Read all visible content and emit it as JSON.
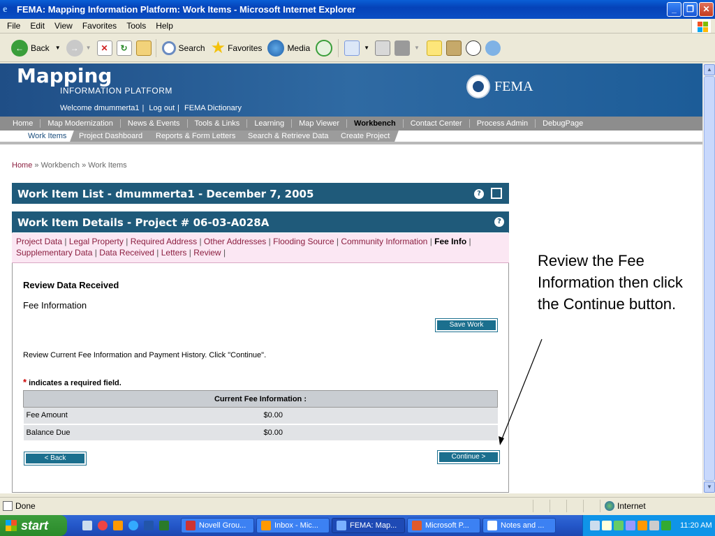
{
  "window": {
    "title": "FEMA: Mapping Information Platform: Work Items - Microsoft Internet Explorer"
  },
  "menu": [
    "File",
    "Edit",
    "View",
    "Favorites",
    "Tools",
    "Help"
  ],
  "toolbar": {
    "back": "Back",
    "search": "Search",
    "favorites": "Favorites",
    "media": "Media"
  },
  "header": {
    "logo_top": "Mapping",
    "logo_bottom": "INFORMATION PLATFORM",
    "welcome": "Welcome dmummerta1",
    "logout": "Log out",
    "dictionary": "FEMA Dictionary",
    "brand": "FEMA"
  },
  "nav_main": [
    "Home",
    "Map Modernization",
    "News & Events",
    "Tools & Links",
    "Learning",
    "Map Viewer",
    "Workbench",
    "Contact Center",
    "Process Admin",
    "DebugPage"
  ],
  "nav_main_active": "Workbench",
  "nav_sub": [
    "Work Items",
    "Project Dashboard",
    "Reports & Form Letters",
    "Search & Retrieve Data",
    "Create Project"
  ],
  "breadcrumb": {
    "home": "Home",
    "rest": "» Workbench » Work Items"
  },
  "work_item_list": {
    "title": "Work Item List - dmummerta1 - December 7, 2005"
  },
  "work_item_details": {
    "title": "Work Item Details - Project # 06-03-A028A"
  },
  "detail_links": [
    "Project Data",
    "Legal Property",
    "Required Address",
    "Other Addresses",
    "Flooding Source",
    "Community Information",
    "Fee Info",
    "Supplementary Data",
    "Data Received",
    "Letters",
    "Review"
  ],
  "detail_links_active": "Fee Info",
  "content": {
    "section_title": "Review Data Received",
    "subsection": "Fee Information",
    "save_button": "Save Work",
    "instruction": "Review Current Fee Information and Payment History. Click \"Continue\".",
    "required_star": "*",
    "required_note": "indicates a required field.",
    "table_header": "Current Fee Information :",
    "rows": [
      {
        "label": "Fee Amount",
        "value": "$0.00"
      },
      {
        "label": "Balance Due",
        "value": "$0.00"
      }
    ],
    "back_button": "< Back",
    "continue_button": "Continue >"
  },
  "callout": "Review the Fee Information then click the Continue button.",
  "status": {
    "text": "Done",
    "zone": "Internet"
  },
  "taskbar": {
    "start": "start",
    "tasks": [
      "Novell Grou...",
      "Inbox - Mic...",
      "FEMA: Map...",
      "Microsoft P...",
      "Notes and ..."
    ],
    "active_task": "FEMA: Map...",
    "clock": "11:20 AM"
  },
  "colors": {
    "header_blue": "#1f4e86",
    "panel_teal": "#1f5a7a",
    "link_maroon": "#8b1e3f",
    "links_bg": "#fbe7f3"
  }
}
